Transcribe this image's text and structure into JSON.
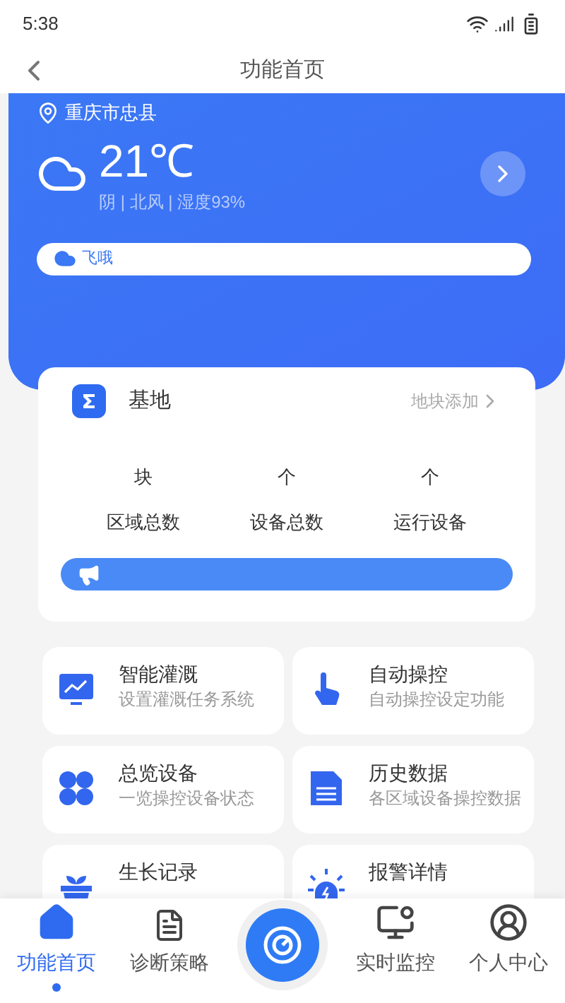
{
  "status_bar": {
    "time": "5:38"
  },
  "header": {
    "title": "功能首页"
  },
  "weather": {
    "location": "重庆市忠县",
    "temperature": "21℃",
    "conditions": "阴 | 北风 | 湿度93%",
    "notice": "飞哦"
  },
  "base": {
    "title": "基地",
    "link": "地块添加",
    "stats": [
      {
        "unit": "块",
        "label": "区域总数"
      },
      {
        "unit": "个",
        "label": "设备总数"
      },
      {
        "unit": "个",
        "label": "运行设备"
      }
    ]
  },
  "features": [
    {
      "kind": "chart",
      "title": "智能灌溉",
      "subtitle": "设置灌溉任务系统"
    },
    {
      "kind": "touch",
      "title": "自动操控",
      "subtitle": "自动操控设定功能"
    },
    {
      "kind": "grid",
      "title": "总览设备",
      "subtitle": "一览操控设备状态"
    },
    {
      "kind": "document",
      "title": "历史数据",
      "subtitle": "各区域设备操控数据"
    },
    {
      "kind": "plant",
      "title": "生长记录"
    },
    {
      "kind": "alarm",
      "title": "报警详情"
    }
  ],
  "tab_bar": [
    {
      "kind": "home",
      "label": "功能首页",
      "selected": true
    },
    {
      "kind": "note",
      "label": "诊断策略",
      "selected": false
    },
    {
      "kind": "center",
      "selected": false
    },
    {
      "kind": "monitor",
      "label": "实时监控",
      "selected": false
    },
    {
      "kind": "user",
      "label": "个人中心",
      "selected": false
    }
  ]
}
